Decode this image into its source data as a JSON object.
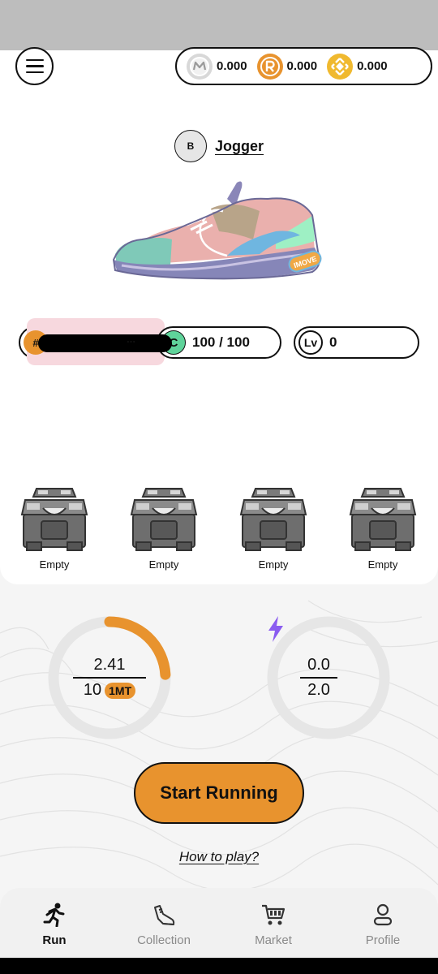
{
  "wallet": {
    "coins": [
      {
        "icon": "gmt-coin-icon",
        "value": "0.000",
        "color": "#d8d8d8"
      },
      {
        "icon": "r-coin-icon",
        "value": "0.000",
        "color": "#e8932e"
      },
      {
        "icon": "bnb-coin-icon",
        "value": "0.000",
        "color": "#f0b92f"
      }
    ]
  },
  "sneaker": {
    "rarity": "B",
    "type": "Jogger",
    "brand_text": "IMOVE"
  },
  "stats": {
    "id_prefix": "#",
    "id_suffix": "...",
    "comfort_icon": "C",
    "comfort": "100 / 100",
    "level_icon": "Lv",
    "level": "0"
  },
  "boxes": [
    {
      "label": "Empty"
    },
    {
      "label": "Empty"
    },
    {
      "label": "Empty"
    },
    {
      "label": "Empty"
    }
  ],
  "earnings": {
    "current": "2.41",
    "max": "10",
    "unit": "1MT",
    "progress": 0.241
  },
  "energy": {
    "current": "0.0",
    "max": "2.0",
    "progress": 0
  },
  "actions": {
    "start": "Start Running",
    "howto": "How to play?"
  },
  "tabs": [
    {
      "label": "Run",
      "icon": "run-icon",
      "active": true
    },
    {
      "label": "Collection",
      "icon": "sneaker-icon",
      "active": false
    },
    {
      "label": "Market",
      "icon": "cart-icon",
      "active": false
    },
    {
      "label": "Profile",
      "icon": "profile-icon",
      "active": false
    }
  ],
  "colors": {
    "accent": "#e8932e",
    "comfort": "#5fd39a",
    "energy": "#8a5cf0",
    "ring_track": "#e6e6e6"
  }
}
